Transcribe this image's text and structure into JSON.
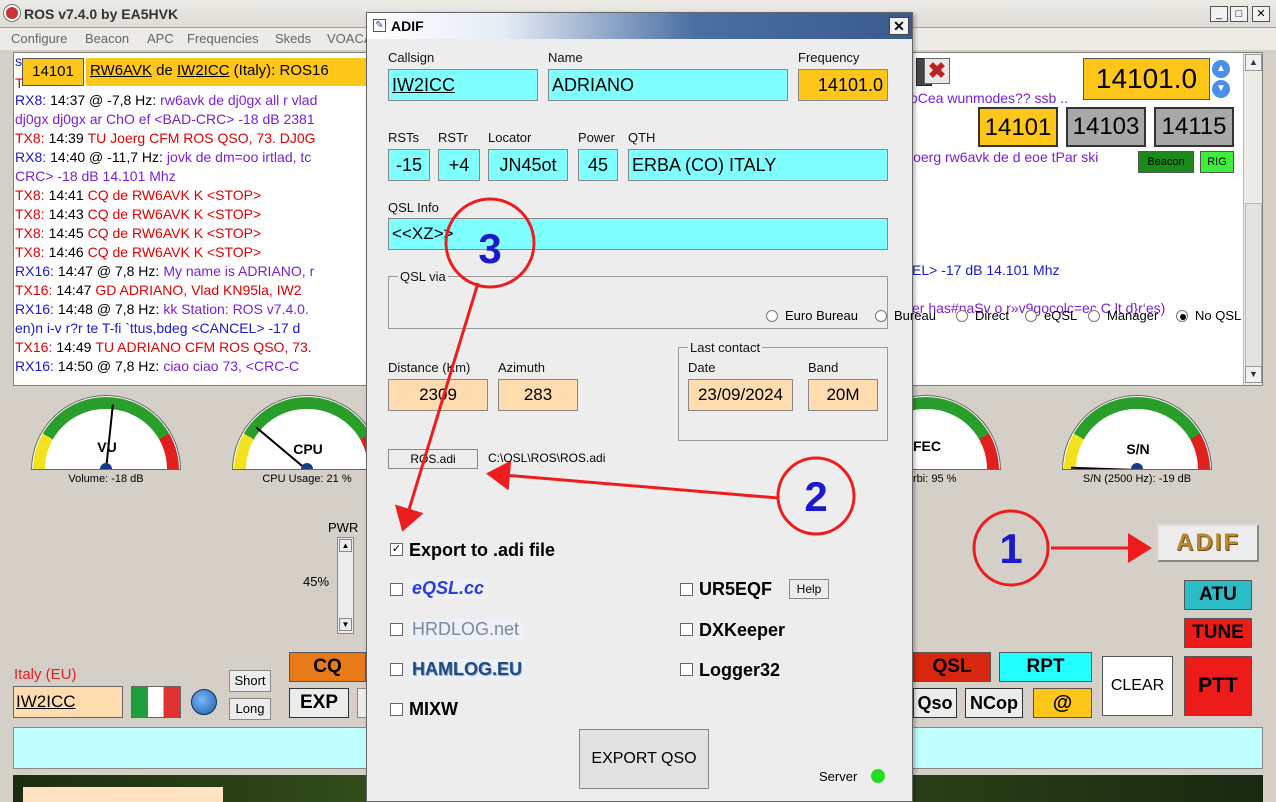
{
  "window": {
    "title": "ROS v7.4.0 by EA5HVK"
  },
  "menu": [
    "Configure",
    "Beacon",
    "APC",
    "Frequencies",
    "Skeds",
    "VOACA"
  ],
  "log": {
    "header_freq": "14101",
    "header_call": "RW6AVK",
    "header_de": "de",
    "header_call2": "IW2ICC",
    "header_rest": "(Italy): ROS16",
    "top_fragment": "s",
    "lines": [
      {
        "p": "RX8:",
        "t": "14:37 @ -7,8 Hz:",
        "m": "rw6avk de dj0gx all r vlad"
      },
      {
        "p": "",
        "t": "",
        "m": "dj0gx dj0gx ar ChO ef <BAD-CRC> -18 dB  2381"
      },
      {
        "p": "TX8:",
        "t": "14:39",
        "m": "TU Joerg CFM ROS QSO, 73. DJ0G"
      },
      {
        "p": "RX8:",
        "t": "14:40 @ -11,7 Hz:",
        "m": "jovk de dm=oo irtlad, tc"
      },
      {
        "p": "",
        "t": "",
        "m": "CRC> -18 dB  14.101 Mhz"
      },
      {
        "p": "TX8:",
        "t": "14:41",
        "m": "CQ de RW6AVK K  <STOP>"
      },
      {
        "p": "TX8:",
        "t": "14:43",
        "m": "CQ de RW6AVK K  <STOP>"
      },
      {
        "p": "TX8:",
        "t": "14:45",
        "m": "CQ de RW6AVK K  <STOP>"
      },
      {
        "p": "TX8:",
        "t": "14:46",
        "m": "CQ de RW6AVK K  <STOP>"
      },
      {
        "p": "RX16:",
        "t": "14:47 @ 7,8 Hz:",
        "m": "My name is ADRIANO, r"
      },
      {
        "p": "TX16:",
        "t": "14:47",
        "m": "GD ADRIANO,  Vlad   KN95la,  IW2"
      },
      {
        "p": "RX16:",
        "t": "14:48 @ 7,8 Hz:",
        "m": "kk Station: ROS v7.4.0."
      },
      {
        "p": "",
        "t": "",
        "m": "en)n i-v r?r te T-fi  `ttus,bdeg <CANCEL> -17 d"
      },
      {
        "p": "TX16:",
        "t": "14:49",
        "m": "TU ADRIANO CFM ROS QSO, 73."
      },
      {
        "p": "RX16:",
        "t": "14:50 @ 7,8 Hz:",
        "m": "ciao  ciao   73, <CRC-C"
      }
    ],
    "right_fragments": [
      "oCea wunmodes?? ssb ..",
      "joerg rw6avk de d eoe  tPar ski",
      "EL> -17 dB  14.101 Mhz",
      "er has#naSv  o r»v9gocolc=ec C lt d}r‘es)"
    ]
  },
  "freq": {
    "main": "14101.0",
    "presets": [
      "14101",
      "14103",
      "14115"
    ],
    "beacon": "Beacon",
    "rig": "RIG"
  },
  "gauges": [
    {
      "label": "VU",
      "caption": "Volume: -18 dB"
    },
    {
      "label": "CPU",
      "caption": "CPU Usage: 21 %"
    },
    {
      "label": "FEC",
      "caption": "rbi: 95 %"
    },
    {
      "label": "S/N",
      "caption": "S/N (2500 Hz): -19 dB"
    }
  ],
  "pwr": {
    "label": "PWR",
    "value": "45%"
  },
  "station": {
    "country": "Italy (EU)",
    "call": "IW2ICC",
    "short": "Short",
    "long": "Long",
    "cq": "CQ",
    "exp": "EXP"
  },
  "buttons": {
    "adif": "ADIF",
    "atu": "ATU",
    "tune": "TUNE",
    "ptt": "PTT",
    "clear": "CLEAR",
    "qsl": "QSL",
    "rpt": "RPT",
    "qso": "Qso",
    "ncop": "NCop",
    "at": "@"
  },
  "annotations": [
    "1",
    "2",
    "3"
  ],
  "dialog": {
    "title": "ADIF",
    "callsign_label": "Callsign",
    "callsign": "IW2ICC",
    "name_label": "Name",
    "name": "ADRIANO",
    "freq_label": "Frequency",
    "freq": "14101.0",
    "rsts_label": "RSTs",
    "rsts": "-15",
    "rstr_label": "RSTr",
    "rstr": "+4",
    "loc_label": "Locator",
    "loc": "JN45ot",
    "power_label": "Power",
    "power": "45",
    "qth_label": "QTH",
    "qth": "ERBA (CO)  ITALY",
    "qslinfo_label": "QSL Info",
    "qslinfo": "<<XZ>>",
    "qslvia_label": "QSL via",
    "qslvia": [
      "Euro Bureau",
      "Bureau",
      "Direct",
      "eQSL",
      "Manager",
      "No QSL"
    ],
    "qslvia_selected": "No QSL",
    "dist_label": "Distance (Km)",
    "dist": "2309",
    "az_label": "Azimuth",
    "az": "283",
    "last_label": "Last contact",
    "date_label": "Date",
    "date": "23/09/2024",
    "band_label": "Band",
    "band": "20M",
    "ros_btn": "ROS.adi",
    "path": "C:\\QSL\\ROS\\ROS.adi",
    "export_label": "Export to .adi file",
    "eqsl": "eQSL.cc",
    "hrdlog": "HRDLOG.net",
    "hamlog": "HAMLOG.EU",
    "mixw": "MIXW",
    "ur5eqf": "UR5EQF",
    "help": "Help",
    "dxkeeper": "DXKeeper",
    "logger32": "Logger32",
    "export_qso": "EXPORT QSO",
    "server": "Server"
  }
}
